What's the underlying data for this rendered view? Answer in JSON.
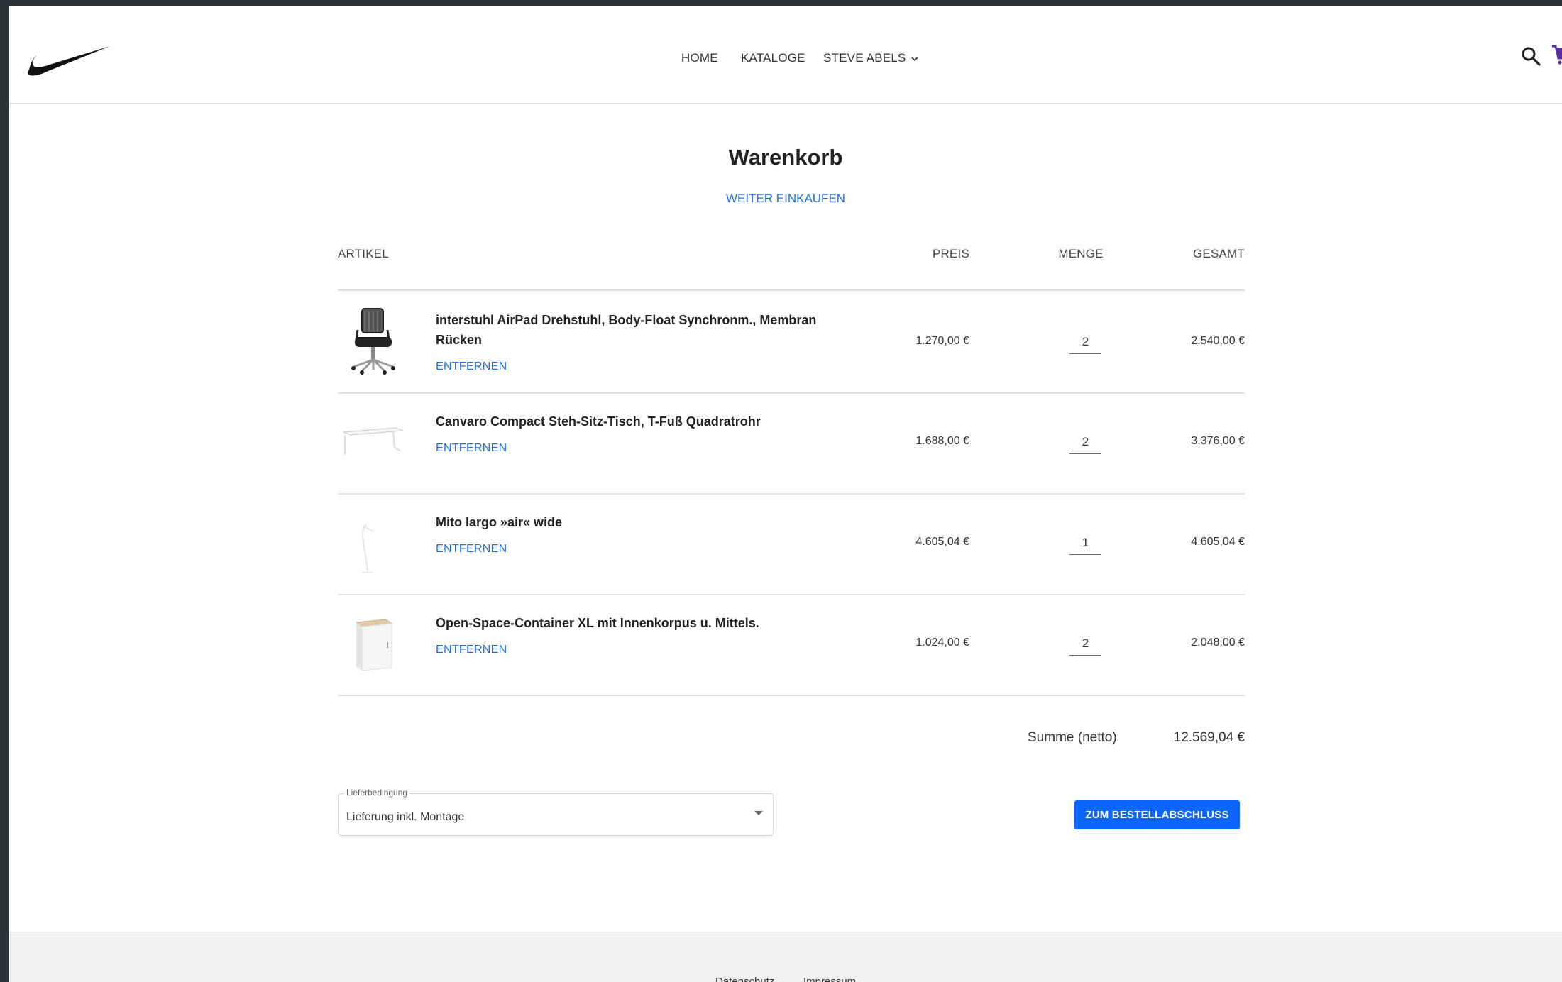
{
  "header": {
    "logo": "nike-swoosh-logo",
    "nav": {
      "home": "HOME",
      "kataloge": "KATALOGE",
      "user": "STEVE ABELS"
    },
    "icons": [
      "search-icon",
      "cart-icon"
    ]
  },
  "cart": {
    "title": "Warenkorb",
    "continue_label": "WEITER EINKAUFEN",
    "columns": {
      "artikel": "ARTIKEL",
      "preis": "PREIS",
      "menge": "MENGE",
      "gesamt": "GESAMT"
    },
    "items": [
      {
        "name": "interstuhl AirPad Drehstuhl, Body-Float Synchronm., Membran Rücken",
        "remove": "ENTFERNEN",
        "price": "1.270,00 €",
        "qty": "2",
        "total": "2.540,00 €"
      },
      {
        "name": "Canvaro Compact Steh-Sitz-Tisch, T-Fuß Quadratrohr",
        "remove": "ENTFERNEN",
        "price": "1.688,00 €",
        "qty": "2",
        "total": "3.376,00 €"
      },
      {
        "name": "Mito largo »air« wide",
        "remove": "ENTFERNEN",
        "price": "4.605,04 €",
        "qty": "1",
        "total": "4.605,04 €"
      },
      {
        "name": "Open-Space-Container XL mit Innenkorpus u. Mittels.",
        "remove": "ENTFERNEN",
        "price": "1.024,00 €",
        "qty": "2",
        "total": "2.048,00 €"
      }
    ],
    "sum_label": "Summe (netto)",
    "sum_value": "12.569,04 €",
    "delivery": {
      "label": "Lieferbedingung",
      "value": "Lieferung inkl. Montage"
    },
    "checkout_label": "ZUM BESTELLABSCHLUSS"
  },
  "footer": {
    "datenschutz": "Datenschutz",
    "impressum": "Impressum"
  },
  "colors": {
    "accent": "#0d66ff",
    "link": "#1f6fe5",
    "cart_icon": "#5a2ca0"
  }
}
